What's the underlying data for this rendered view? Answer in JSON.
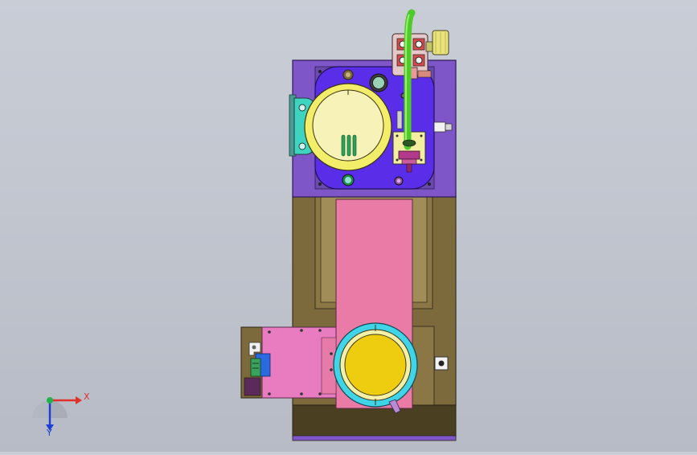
{
  "viewport": {
    "background": "#c5c9d2"
  },
  "triad": {
    "x_label": "X",
    "y_label": "Y",
    "x_color": "#e0302a",
    "y_color": "#1c3fd8",
    "z_color": "#22b24c"
  },
  "model": {
    "colors": {
      "plate_purple": "#7e56c8",
      "inner_blue": "#5a2de8",
      "body_olive": "#7c6a3c",
      "slide_pink": "#e97ba6",
      "tube_green": "#4ecb2a",
      "disc_yellow": "#f4ea9e",
      "ring_cyan": "#3fd4e8",
      "knob_yellow": "#e8e37a"
    }
  }
}
